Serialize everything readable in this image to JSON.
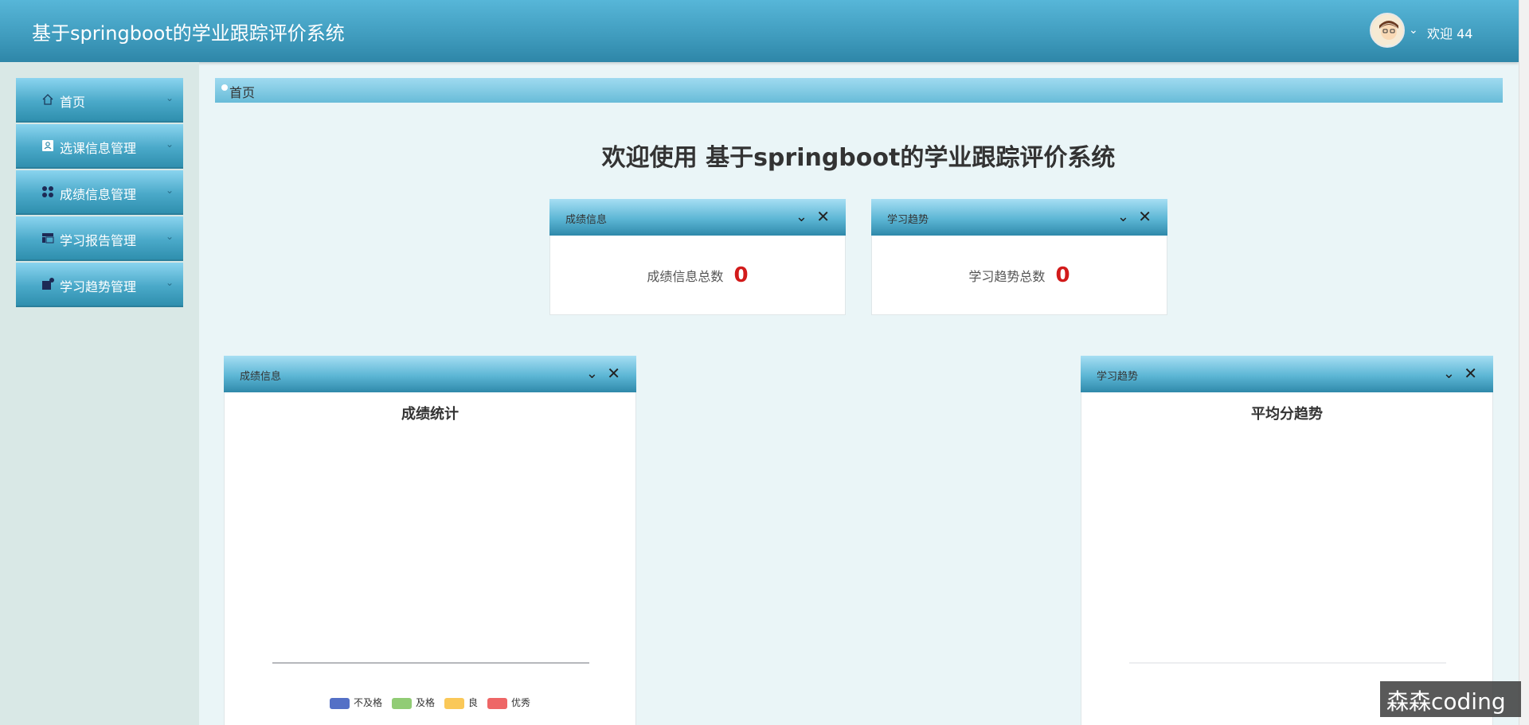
{
  "header": {
    "title": "基于springboot的学业跟踪评价系统",
    "welcome": "欢迎 44"
  },
  "sidebar": {
    "items": [
      {
        "label": "首页",
        "icon": "home-icon"
      },
      {
        "label": "选课信息管理",
        "icon": "contact-card-icon"
      },
      {
        "label": "成绩信息管理",
        "icon": "apps-icon"
      },
      {
        "label": "学习报告管理",
        "icon": "layout-icon"
      },
      {
        "label": "学习趋势管理",
        "icon": "chart-icon"
      }
    ]
  },
  "breadcrumb": {
    "text": "首页"
  },
  "main": {
    "welcome_title": "欢迎使用 基于springboot的学业跟踪评价系统",
    "stat_panels": [
      {
        "title": "成绩信息",
        "label": "成绩信息总数",
        "value": "0"
      },
      {
        "title": "学习趋势",
        "label": "学习趋势总数",
        "value": "0"
      }
    ],
    "chart_panels": [
      {
        "title": "成绩信息",
        "chart_title": "成绩统计"
      },
      {
        "title": "学习趋势",
        "chart_title": "平均分趋势"
      }
    ]
  },
  "chart_data": [
    {
      "type": "bar",
      "title": "成绩统计",
      "categories": [],
      "series": [
        {
          "name": "不及格",
          "color": "#5470c6",
          "values": []
        },
        {
          "name": "及格",
          "color": "#91cc75",
          "values": []
        },
        {
          "name": "良",
          "color": "#fac858",
          "values": []
        },
        {
          "name": "优秀",
          "color": "#ee6666",
          "values": []
        }
      ],
      "legend": "bottom"
    },
    {
      "type": "line",
      "title": "平均分趋势",
      "categories": [],
      "series": []
    }
  ],
  "watermark": "森森coding"
}
